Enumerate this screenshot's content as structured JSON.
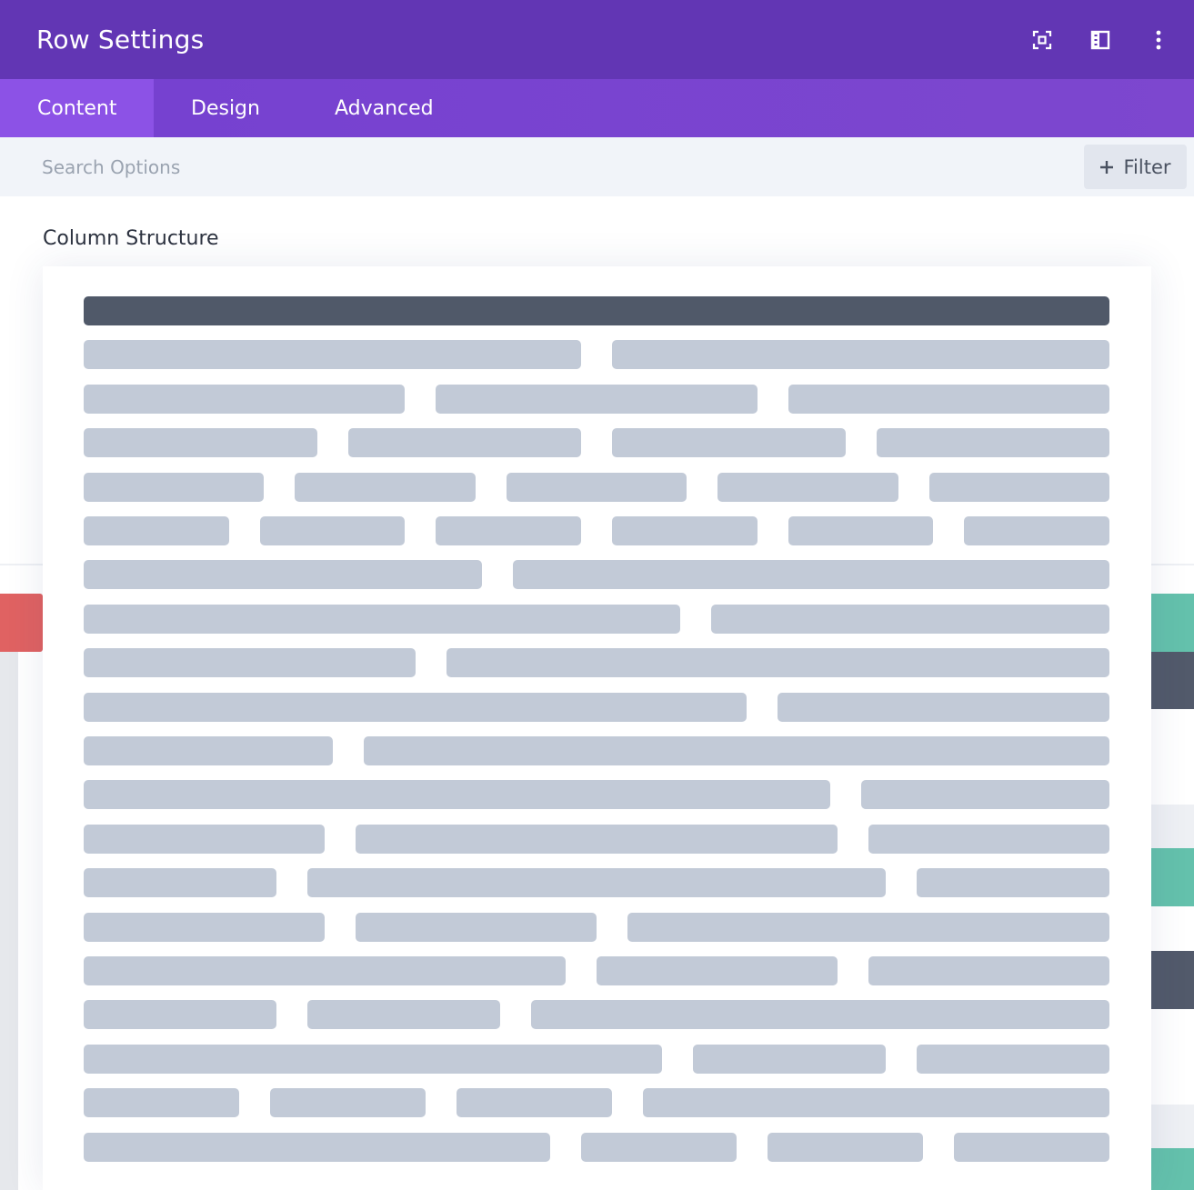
{
  "header": {
    "title": "Row Settings",
    "icons": [
      "expand-icon",
      "split-view-icon",
      "more-options-icon"
    ]
  },
  "tabs": [
    {
      "label": "Content",
      "active": true
    },
    {
      "label": "Design",
      "active": false
    },
    {
      "label": "Advanced",
      "active": false
    }
  ],
  "search": {
    "placeholder": "Search Options",
    "value": ""
  },
  "filter": {
    "icon": "plus-icon",
    "label": "Filter"
  },
  "column_structure": {
    "title": "Column Structure",
    "selected_index": 0,
    "layouts": [
      [
        "1"
      ],
      [
        "1/2",
        "1/2"
      ],
      [
        "1/3",
        "1/3",
        "1/3"
      ],
      [
        "1/4",
        "1/4",
        "1/4",
        "1/4"
      ],
      [
        "1/5",
        "1/5",
        "1/5",
        "1/5",
        "1/5"
      ],
      [
        "1/6",
        "1/6",
        "1/6",
        "1/6",
        "1/6",
        "1/6"
      ],
      [
        "2/5",
        "3/5"
      ],
      [
        "3/5",
        "2/5"
      ],
      [
        "1/3",
        "2/3"
      ],
      [
        "2/3",
        "1/3"
      ],
      [
        "1/4",
        "3/4"
      ],
      [
        "3/4",
        "1/4"
      ],
      [
        "1/4",
        "1/2",
        "1/4"
      ],
      [
        "1/5",
        "3/5",
        "1/5"
      ],
      [
        "1/4",
        "1/4",
        "1/2"
      ],
      [
        "1/2",
        "1/4",
        "1/4"
      ],
      [
        "1/5",
        "1/5",
        "3/5"
      ],
      [
        "3/5",
        "1/5",
        "1/5"
      ],
      [
        "1/6",
        "1/6",
        "1/6",
        "1/2"
      ],
      [
        "1/2",
        "1/6",
        "1/6",
        "1/6"
      ]
    ]
  },
  "colors": {
    "header_bg": "#6236b4",
    "tabs_bg": "#7540d0",
    "active_tab_bg": "#8c52e6",
    "search_bg": "#f1f4f9",
    "column_default": "#c2cad7",
    "column_selected": "#505969",
    "accent_red": "#e06262",
    "accent_teal": "#64c1ac",
    "accent_slate": "#525a6b"
  }
}
